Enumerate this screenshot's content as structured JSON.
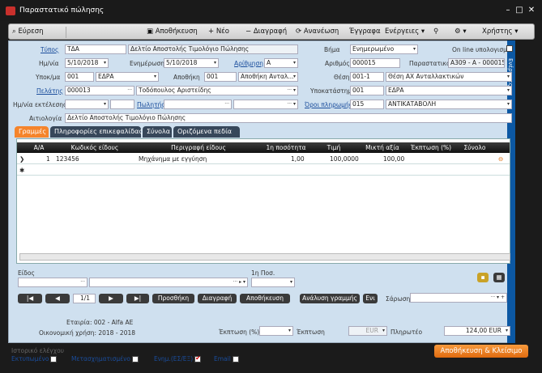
{
  "window": {
    "title": "Παραστατικό πώλησης"
  },
  "toolbar": {
    "search": "Εύρεση",
    "save": "Αποθήκευση",
    "new": "Νέο",
    "delete": "Διαγραφή",
    "refresh": "Ανανέωση",
    "docs": "Έγγραφα",
    "actions": "Ενέργειες",
    "users": "Χρήστης"
  },
  "header": {
    "type_label": "Τύπος",
    "type_code": "ΤΔΑ",
    "type_name": "Δελτίο Αποστολής Τιμολόγιο Πώλησης",
    "step_label": "Βήμα",
    "step_value": "Ενημερωμένο",
    "online_label": "On line υπολογισμοί",
    "date_label": "Ημ/νία",
    "date_value": "5/10/2018",
    "update_label": "Ενημέρωση",
    "update_value": "5/10/2018",
    "numbering_label": "Αρίθμηση",
    "numbering_value": "Α",
    "number_label": "Αριθμός",
    "number_value": "000015",
    "doc_label": "Παραστατικό",
    "doc_value": "Α309 - Α - 000015",
    "branch_label": "Υποκ/μα",
    "branch_code": "001",
    "branch_name": "ΕΔΡΑ",
    "warehouse_label": "Αποθήκη",
    "warehouse_code": "001",
    "warehouse_name": "Αποθήκη Ανταλ...",
    "position_label": "Θέση",
    "position_code": "001-1",
    "position_name": "Θέση ΑΧ Ανταλλακτικών",
    "customer_label": "Πελάτης",
    "customer_code": "000013",
    "customer_name": "Τοδόπουλος Αριστείδης",
    "subbranch_label": "Υποκατάστημα",
    "subbranch_code": "001",
    "subbranch_name": "ΕΔΡΑ",
    "exec_label": "Ημ/νία εκτέλεσης",
    "seller_label": "Πωλητής",
    "terms_label": "Όροι πληρωμής",
    "terms_code": "015",
    "terms_name": "ΑΝΤΙΚΑΤΑΒΟΛΗ",
    "reason_label": "Αιτιολογία",
    "reason_value": "Δελτίο Αποστολής Τιμολόγιο Πώλησης"
  },
  "side_panel": "Ενέργειες",
  "tabs": [
    "Γραμμές",
    "Πληροφορίες επικεφαλίδας",
    "Σύνολα",
    "Οριζόμενα πεδία"
  ],
  "grid": {
    "columns": [
      "Α/Α",
      "Κωδικός είδους",
      "Περιγραφή είδους",
      "1η ποσότητα",
      "Τιμή",
      "Μικτή αξία",
      "Έκπτωση (%)",
      "Σύνολο"
    ],
    "rows": [
      {
        "aa": "1",
        "code": "123456",
        "desc": "Μηχάνημα με εγγύηση",
        "qty": "1,00",
        "price": "100,0000",
        "gross": "100,00"
      }
    ]
  },
  "lower": {
    "item_label": "Είδος",
    "qty_label": "1η Ποσ.",
    "page": "1/1",
    "add": "Προσθήκη",
    "delete": "Διαγραφή",
    "save": "Αποθήκευση",
    "analysis": "Ανάλυση γραμμής",
    "more": "Ενι",
    "scan_label": "Σάρωση"
  },
  "footer": {
    "company": "Εταιρία: 002 - Alfa AE",
    "fiscal": "Οικονομική χρήση: 2018 - 2018",
    "discount_pct_label": "Έκπτωση (%)",
    "discount_label": "Έκπτωση",
    "discount_cur": "EUR",
    "payable_label": "Πληρωτέο",
    "payable_value": "124,00",
    "payable_cur": "EUR",
    "history": "Ιστορικό ελέγχου",
    "printed": "Εκτυπωμένο",
    "transformed": "Μετασχηματισμένο",
    "updated": "Ενημ.(ΕΣ/ΕΞ)",
    "email": "Email",
    "save_close": "Αποθήκευση & Κλείσιμο"
  },
  "colors": {
    "accent": "#f5842b",
    "side": "#0c58a3",
    "panel": "#cfe0ef"
  }
}
